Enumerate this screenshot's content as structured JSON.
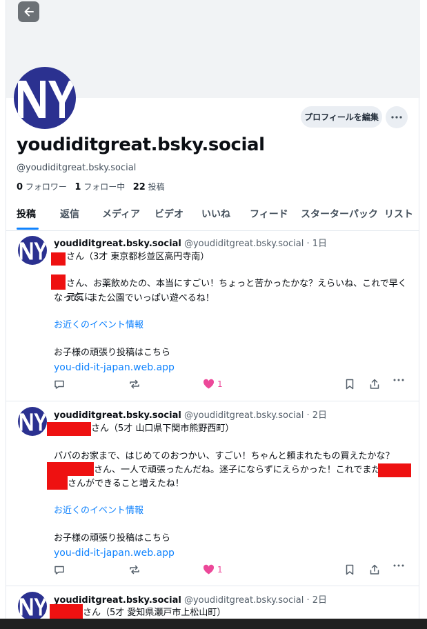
{
  "profile": {
    "display_name": "youdiditgreat.bsky.social",
    "handle": "@youdiditgreat.bsky.social",
    "edit_label": "プロフィールを編集",
    "followers_count": "0",
    "followers_label": "フォロワー",
    "following_count": "1",
    "following_label": "フォロー中",
    "posts_count": "22",
    "posts_label": "投稿"
  },
  "tabs": [
    "投稿",
    "返信",
    "メディア",
    "ビデオ",
    "いいね",
    "フィード",
    "スターターパック",
    "リスト"
  ],
  "posts": [
    {
      "author": "youdiditgreat.bsky.social",
      "meta": "@youdiditgreat.bsky.social · 1日",
      "line1": "さん（3才 東京都杉並区高円寺南）",
      "body1": "さん、お薬飲めたの、本当にすごい！ちょっと苦かったかな？えらいね、これで早く元気に",
      "body2": "なって、また公園でいっぱい遊べるね！",
      "event_link": "お近くのイベント情報",
      "cta": "お子様の頑張り投稿はこちら",
      "url": "you-did-it-japan.web.app",
      "likes": "1"
    },
    {
      "author": "youdiditgreat.bsky.social",
      "meta": "@youdiditgreat.bsky.social · 2日",
      "line1": "さん（5才 山口県下関市熊野西町）",
      "body1": "パパのお家まで、はじめてのおつかい、すごい！ちゃんと頼まれたもの買えたかな？",
      "body2": "さん、一人で頑張ったんだね。迷子にならずにえらかった！これでまた一つ",
      "body3": "さんができること増えたね！",
      "event_link": "お近くのイベント情報",
      "cta": "お子様の頑張り投稿はこちら",
      "url": "you-did-it-japan.web.app",
      "likes": "1"
    },
    {
      "author": "youdiditgreat.bsky.social",
      "meta": "@youdiditgreat.bsky.social · 2日",
      "line1": "さん（5才 愛知県瀬戸市上松山町）"
    }
  ],
  "colors": {
    "accent": "#1083fe",
    "avatar": "#2b3190",
    "like": "#ec4899",
    "redaction": "#ee1111"
  },
  "icons": [
    "back-arrow-icon",
    "more-icon",
    "reply-icon",
    "repost-icon",
    "heart-icon",
    "bookmark-icon",
    "share-icon",
    "ellipsis-icon"
  ]
}
